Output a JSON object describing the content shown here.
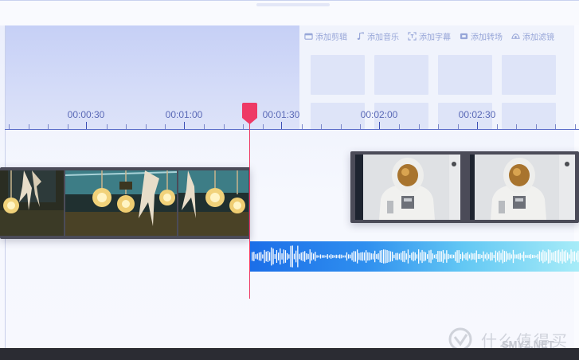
{
  "toolbar": {
    "items": [
      {
        "label": "添加剪辑",
        "icon": "clip-icon"
      },
      {
        "label": "添加音乐",
        "icon": "music-note-icon"
      },
      {
        "label": "添加字幕",
        "icon": "subtitle-icon"
      },
      {
        "label": "添加转场",
        "icon": "transition-icon"
      },
      {
        "label": "添加滤镜",
        "icon": "filter-icon"
      }
    ]
  },
  "timeline": {
    "time_labels": [
      "00:00:30",
      "00:01:00",
      "00:01:30",
      "00:02:00",
      "00:02:30"
    ]
  },
  "clips": [
    {
      "name": "lightbulbs-clip",
      "frames": 3
    },
    {
      "name": "astronaut-clip",
      "frames": 2
    }
  ],
  "audio": {
    "name": "audio-track"
  },
  "watermark": {
    "text": "什么值得买",
    "sub": "SMYZ.NET"
  },
  "colors": {
    "accent": "#5b6ab7",
    "playhead": "#ee3a66",
    "audio_start": "#1b6ee8",
    "audio_end": "#a7ecf8"
  }
}
